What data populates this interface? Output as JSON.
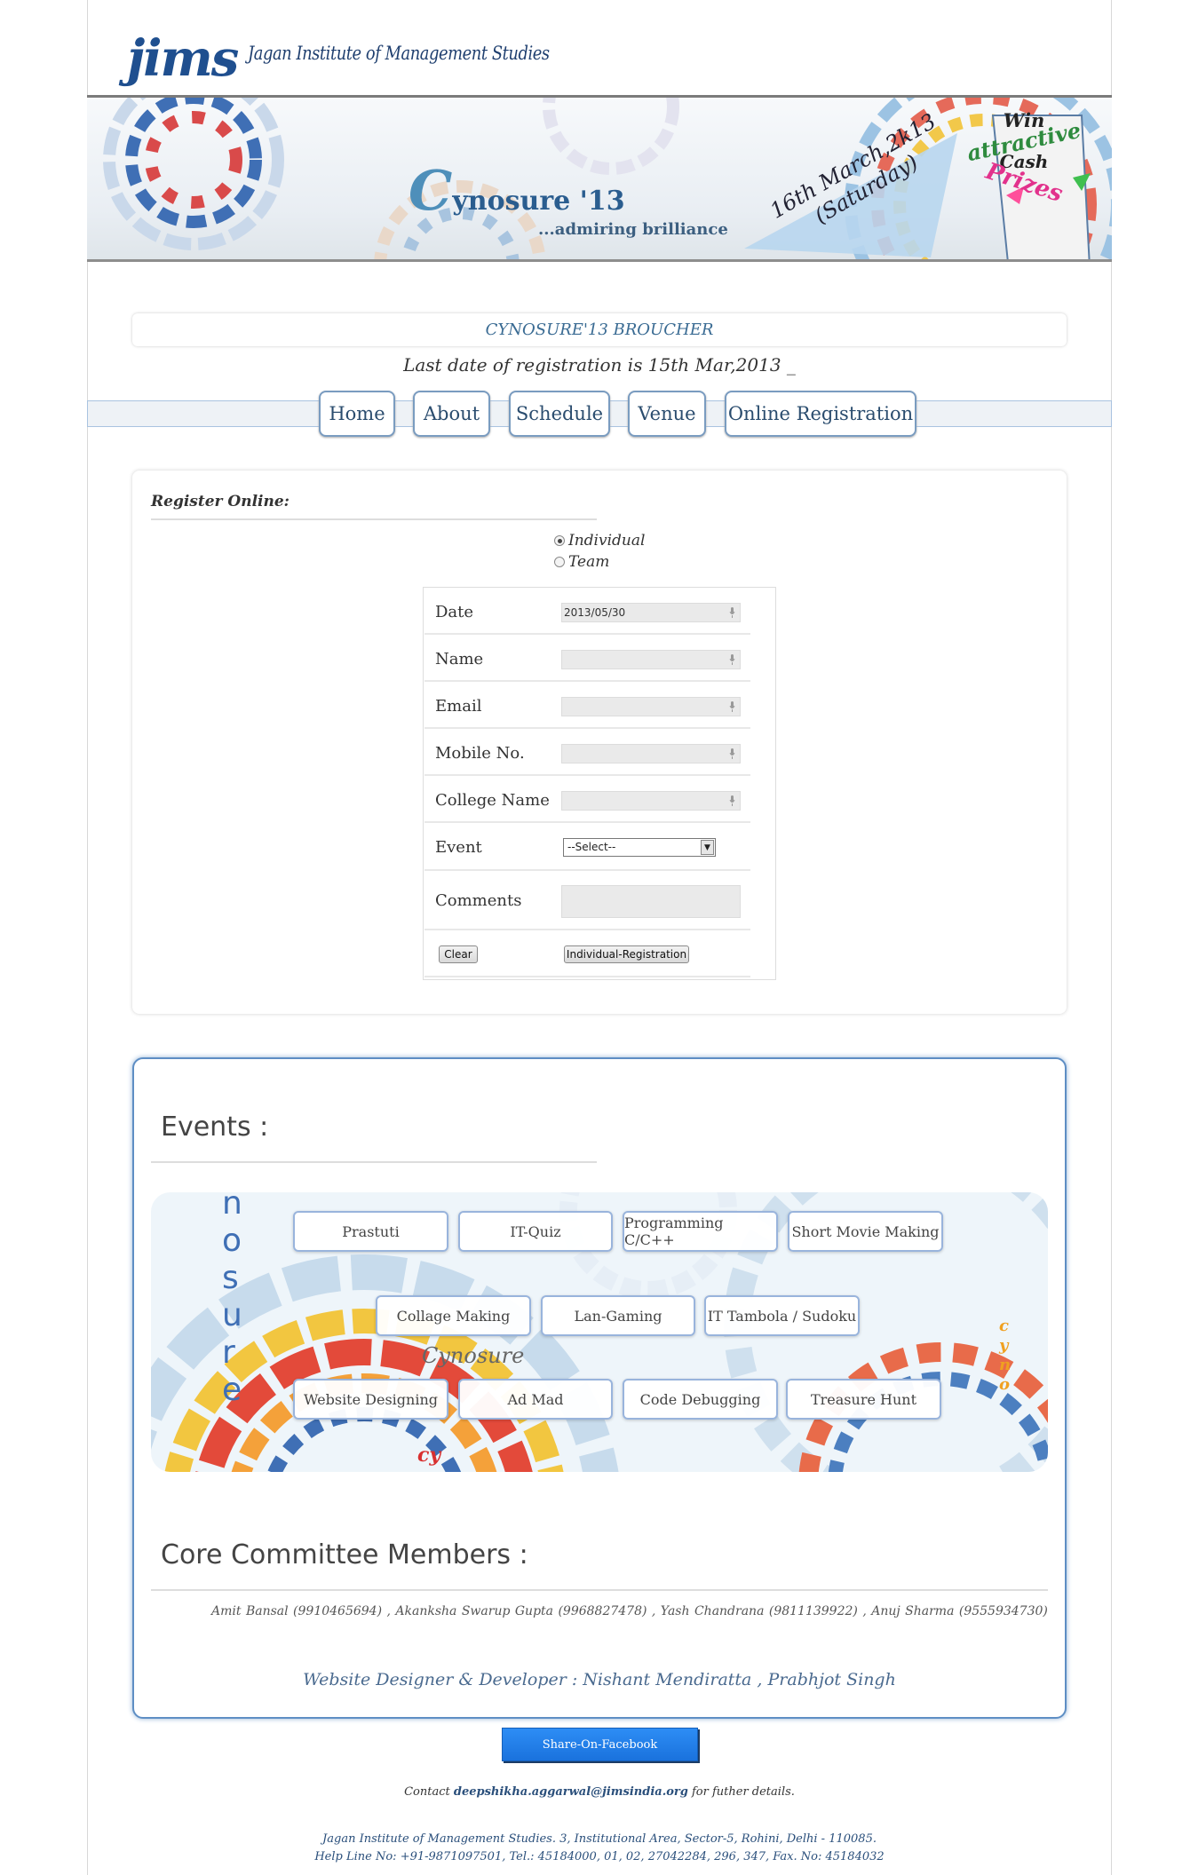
{
  "header": {
    "logo_mark": "jims",
    "logo_text": "Jagan Institute of Management Studies"
  },
  "banner": {
    "title_cap": "C",
    "title_rest": "ynosure '13",
    "subtitle": "...admiring brilliance",
    "date_line1": "16th March,2k13",
    "date_line2": "(Saturday)",
    "prize_line1": "Win",
    "prize_line2": "attractive",
    "prize_line3": "Cash",
    "prize_line4": "Prizes"
  },
  "broucher_link": "CYNOSURE'13 BROUCHER",
  "last_date": "Last date of registration is 15th Mar,2013 _",
  "nav": [
    {
      "label": "Home"
    },
    {
      "label": "About"
    },
    {
      "label": "Schedule"
    },
    {
      "label": "Venue"
    },
    {
      "label": "Online Registration"
    }
  ],
  "register": {
    "heading": "Register Online:",
    "radio_individual": "Individual",
    "radio_team": "Team",
    "selected": "Individual",
    "fields": {
      "date_label": "Date",
      "date_value": "2013/05/30",
      "name_label": "Name",
      "name_value": "",
      "email_label": "Email",
      "email_value": "",
      "mobile_label": "Mobile No.",
      "mobile_value": "",
      "college_label": "College Name",
      "college_value": "",
      "event_label": "Event",
      "event_selected": "--Select--",
      "comments_label": "Comments",
      "comments_value": ""
    },
    "clear_button": "Clear",
    "submit_button": "Individual-Registration"
  },
  "events": {
    "title": "Events :",
    "backdrop_text": "Cynosure",
    "vertical_text": "nosure",
    "vertical_small": "cyno",
    "corner_text": "cy",
    "items": [
      "Prastuti",
      "IT-Quiz",
      "Programming C/C++",
      "Short Movie Making",
      "Collage Making",
      "Lan-Gaming",
      "IT Tambola / Sudoku",
      "Website Designing",
      "Ad Mad",
      "Code Debugging",
      "Treasure Hunt"
    ]
  },
  "committee": {
    "title": "Core Committee Members :",
    "members": "Amit Bansal (9910465694) ,     Akanksha Swarup Gupta (9968827478) ,     Yash Chandrana (9811139922) ,     Anuj Sharma (9555934730)"
  },
  "designer": "Website Designer & Developer : Nishant Mendiratta , Prabhjot Singh",
  "facebook_button": "Share-On-Facebook",
  "contact": {
    "prefix": "Contact",
    "email": "deepshikha.aggarwal@jimsindia.org",
    "suffix": "for futher details."
  },
  "address": {
    "line1": "Jagan Institute of Management Studies. 3, Institutional Area, Sector-5, Rohini, Delhi - 110085.",
    "line2": "Help Line No: +91-9871097501, Tel.: 45184000, 01, 02, 27042284, 296, 347, Fax. No: 45184032"
  },
  "colors": {
    "accent": "#5e8ec4",
    "link": "#3a6b93",
    "facebook": "#1f7ee9"
  }
}
